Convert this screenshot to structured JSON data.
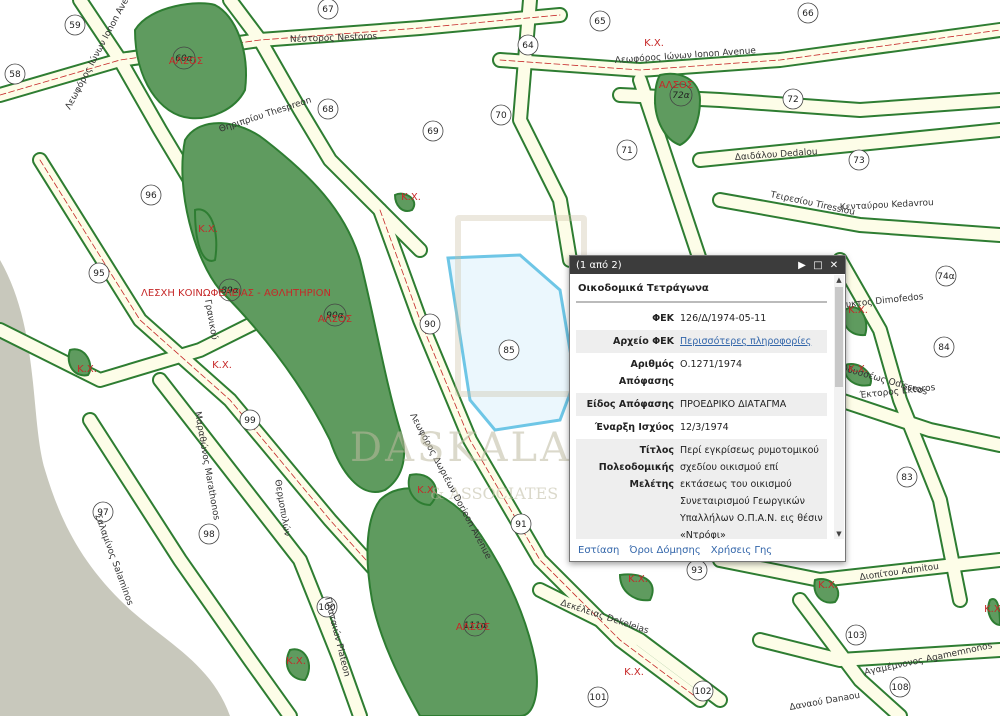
{
  "map": {
    "blocks": [
      "59",
      "67",
      "65",
      "66",
      "58",
      "64",
      "60α",
      "72α",
      "72",
      "68",
      "69",
      "70",
      "71",
      "73",
      "96",
      "95",
      "74α",
      "84",
      "89α",
      "90α",
      "90",
      "85",
      "99",
      "83",
      "97",
      "98",
      "91",
      "93",
      "100",
      "111α",
      "103",
      "101",
      "102",
      "108"
    ],
    "streets": [
      "Λεωφόρος Ιώνων Ionon Avenue",
      "Λεωφόρος Ιώνων Ionon Avenue",
      "Νέστορος Nestoros",
      "Δαιδάλου Dedalou",
      "Κενταύρου Kedavrou",
      "Τειρεσίου Tiressiou",
      "Διομφυκτος Dimofedos",
      "Έκτορος Ektoros",
      "Λεωφόρος Δωριέων Dorieon Avenue",
      "Θηριπρίου Thespreon",
      "Σαλαμίνος Salaminos",
      "Μαραθώνος Marathonos",
      "Πλαταιών Plateon",
      "Θερμοπυλών",
      "Διοπίτου Admitou",
      "Αγαμέμνονος Agamemnonos",
      "Δαναού Danaou",
      "Δεκέλειας Dekeleias",
      "Οδυσσέως Odisseos",
      "Γρανικού"
    ],
    "kx_label": "Κ.Χ.",
    "aleso_label": "ΑΛΣΟΣ",
    "club_label": "ΛΕΣΧΗ ΚΟΙΝΩΦΕΛΕΙΑΣ - ΑΘΛΗΤΗΡΙΟΝ"
  },
  "popup": {
    "count": "(1 από 2)",
    "title": "Οικοδομικά Τετράγωνα",
    "fields": [
      {
        "key": "ΦΕΚ",
        "value": "126/Δ/1974-05-11"
      },
      {
        "key": "Αρχείο ΦΕΚ",
        "value": "Περισσότερες πληροφορίες",
        "link": true
      },
      {
        "key": "Αριθμός Απόφασης",
        "value": "Ο.1271/1974"
      },
      {
        "key": "Είδος Απόφασης",
        "value": "ΠΡΟΕΔΡΙΚΟ ΔΙΑΤΑΓΜΑ"
      },
      {
        "key": "Έναρξη Ισχύος",
        "value": "12/3/1974"
      },
      {
        "key": "Τίτλος Πολεοδομικής Μελέτης",
        "value": "Περί εγκρίσεως ρυμοτομικού σχεδίου οικισμού επί εκτάσεως του οικισμού Συνεταιρισμού Γεωργικών Υπαλλήλων Ο.Π.Α.Ν. εις θέσιν «Ντρόφι»"
      }
    ],
    "footer": [
      "Εστίαση",
      "Όροι Δόμησης",
      "Χρήσεις Γης"
    ]
  },
  "watermark": {
    "line1": "DASKALAKIS",
    "line2": "& ASSOCIATES"
  },
  "colors": {
    "park": "#5f9b5f",
    "road_border": "#2e7d32",
    "road_red": "#c62828",
    "road_fill": "#fdfde8",
    "sea": "#c8c8bc",
    "popup_header": "#3c3c3c",
    "link": "#3366aa"
  }
}
